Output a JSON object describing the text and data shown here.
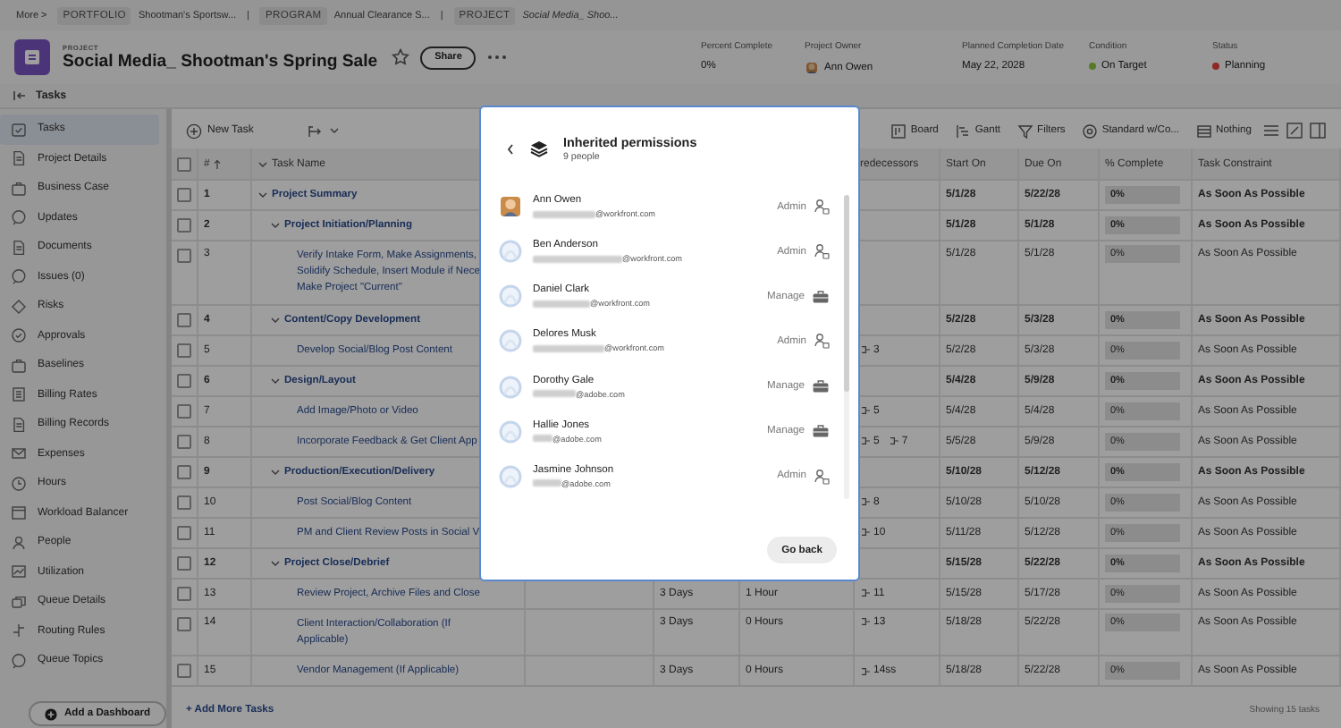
{
  "breadcrumb": {
    "more": "More >",
    "items": [
      {
        "tag": "PORTFOLIO",
        "name": "Shootman's Sportsw...",
        "divider": "|"
      },
      {
        "tag": "PROGRAM",
        "name": "Annual Clearance S...",
        "divider": "|"
      },
      {
        "tag": "PROJECT",
        "name": "Social Media_ Shoo..."
      }
    ]
  },
  "project": {
    "kind_label": "PROJECT",
    "title": "Social Media_ Shootman's Spring Sale",
    "favorite": false,
    "share": "Share"
  },
  "stats": [
    {
      "label": "Percent Complete",
      "value": "0%",
      "kind": "text"
    },
    {
      "label": "Project Owner",
      "value": "Ann Owen",
      "kind": "person"
    },
    {
      "label": "Planned Completion Date",
      "value": "May 22, 2028",
      "kind": "text"
    },
    {
      "label": "Condition",
      "value": "On Target",
      "kind": "status",
      "color": "#577b27"
    },
    {
      "label": "Status",
      "value": "Planning",
      "kind": "status",
      "color": "#902825"
    }
  ],
  "page_title": "Tasks",
  "sidebar": [
    {
      "label": "Tasks",
      "selected": true
    },
    {
      "label": "Project Details",
      "selected": false
    },
    {
      "label": "Business Case",
      "selected": false
    },
    {
      "label": "Updates",
      "selected": false
    },
    {
      "label": "Documents",
      "selected": false
    },
    {
      "label": "Issues (0)",
      "selected": false
    },
    {
      "label": "Risks",
      "selected": false
    },
    {
      "label": "Approvals",
      "selected": false
    },
    {
      "label": "Baselines",
      "selected": false
    },
    {
      "label": "Billing Rates",
      "selected": false
    },
    {
      "label": "Billing Records",
      "selected": false
    },
    {
      "label": "Expenses",
      "selected": false
    },
    {
      "label": "Hours",
      "selected": false
    },
    {
      "label": "Workload Balancer",
      "selected": false
    },
    {
      "label": "People",
      "selected": false
    },
    {
      "label": "Utilization",
      "selected": false
    },
    {
      "label": "Queue Details",
      "selected": false
    },
    {
      "label": "Routing Rules",
      "selected": false
    },
    {
      "label": "Queue Topics",
      "selected": false
    }
  ],
  "dashboard_button": "Add a Dashboard",
  "toolbar": {
    "new_task": "New Task",
    "views": [
      {
        "label": "Board"
      },
      {
        "label": "Gantt"
      },
      {
        "label": "Filters"
      },
      {
        "label": "Standard w/Co..."
      },
      {
        "label": "Nothing"
      }
    ]
  },
  "table": {
    "all_checked": false,
    "columns": {
      "number": "#",
      "name": "Task Name",
      "predecessors": "redecessors",
      "start": "Start On",
      "due": "Due On",
      "complete": "% Complete",
      "constraint": "Task Constraint"
    },
    "rows": [
      {
        "checked": false,
        "number": "1",
        "name": "Project Summary",
        "expanded": true,
        "start": "5/1/28",
        "due": "5/22/28",
        "complete": "0%",
        "level": 0,
        "constraint": "As Soon As Possible",
        "children": [
          {
            "checked": false,
            "number": "2",
            "name": "Project Initiation/Planning",
            "expanded": true,
            "start": "5/1/28",
            "due": "5/1/28",
            "complete": "0%",
            "level": 0,
            "constraint": "As Soon As Possible",
            "children": [
              {
                "checked": false,
                "number": "3",
                "name": "Verify Intake Form, Make Assignments,\nSolidify Schedule, Insert Module if Nece\nMake Project \"Current\"",
                "start": "5/1/28",
                "due": "5/1/28",
                "complete": "0%",
                "level": 0,
                "constraint": "As Soon As Possible"
              }
            ]
          },
          {
            "checked": false,
            "number": "4",
            "name": "Content/Copy Development",
            "expanded": true,
            "start": "5/2/28",
            "due": "5/3/28",
            "complete": "0%",
            "level": 0,
            "constraint": "As Soon As Possible",
            "children": [
              {
                "checked": false,
                "number": "5",
                "name": "Develop Social/Blog Post Content",
                "predecessors": [
                  "3"
                ],
                "start": "5/2/28",
                "due": "5/3/28",
                "complete": "0%",
                "level": 0,
                "constraint": "As Soon As Possible"
              }
            ]
          },
          {
            "checked": false,
            "number": "6",
            "name": "Design/Layout",
            "expanded": true,
            "start": "5/4/28",
            "due": "5/9/28",
            "complete": "0%",
            "level": 0,
            "constraint": "As Soon As Possible",
            "children": [
              {
                "checked": false,
                "number": "7",
                "name": "Add Image/Photo or Video",
                "predecessors": [
                  "5"
                ],
                "start": "5/4/28",
                "due": "5/4/28",
                "complete": "0%",
                "level": 0,
                "constraint": "As Soon As Possible"
              },
              {
                "checked": false,
                "number": "8",
                "name": "Incorporate Feedback & Get Client App",
                "predecessors": [
                  "5",
                  "7"
                ],
                "start": "5/5/28",
                "due": "5/9/28",
                "complete": "0%",
                "level": 0,
                "constraint": "As Soon As Possible"
              }
            ]
          },
          {
            "checked": false,
            "number": "9",
            "name": "Production/Execution/Delivery",
            "expanded": true,
            "start": "5/10/28",
            "due": "5/12/28",
            "complete": "0%",
            "level": 0,
            "constraint": "As Soon As Possible",
            "children": [
              {
                "checked": false,
                "number": "10",
                "name": "Post Social/Blog Content",
                "predecessors": [
                  "8"
                ],
                "start": "5/10/28",
                "due": "5/10/28",
                "complete": "0%",
                "level": 0,
                "constraint": "As Soon As Possible"
              },
              {
                "checked": false,
                "number": "11",
                "name": "PM and Client Review Posts in Social V",
                "predecessors": [
                  "10"
                ],
                "start": "5/11/28",
                "due": "5/12/28",
                "complete": "0%",
                "level": 0,
                "constraint": "As Soon As Possible"
              }
            ]
          },
          {
            "checked": false,
            "number": "12",
            "name": "Project Close/Debrief",
            "expanded": true,
            "start": "5/15/28",
            "due": "5/22/28",
            "complete": "0%",
            "level": 0,
            "constraint": "As Soon As Possible",
            "children": [
              {
                "checked": false,
                "number": "13",
                "name": "Review Project, Archive Files and Close",
                "duration": "3 Days",
                "hours": "1 Hour",
                "predecessors": [
                  "11"
                ],
                "start": "5/15/28",
                "due": "5/17/28",
                "complete": "0%",
                "level": 0,
                "constraint": "As Soon As Possible"
              },
              {
                "checked": false,
                "number": "14",
                "name": "Client Interaction/Collaboration (If\nApplicable)",
                "duration": "3 Days",
                "hours": "0 Hours",
                "predecessors": [
                  "13"
                ],
                "start": "5/18/28",
                "due": "5/22/28",
                "complete": "0%",
                "level": 0,
                "constraint": "As Soon As Possible"
              },
              {
                "checked": false,
                "number": "15",
                "name": "Vendor Management (If Applicable)",
                "duration": "3 Days",
                "hours": "0 Hours",
                "predecessors": [
                  "14ss"
                ],
                "start": "5/18/28",
                "due": "5/22/28",
                "complete": "0%",
                "level": 0,
                "constraint": "As Soon As Possible"
              }
            ]
          }
        ]
      }
    ]
  },
  "add_tasks": "+ Add More Tasks",
  "showing": "Showing 15 tasks",
  "modal": {
    "title": "Inherited permissions",
    "subtitle": "9 people",
    "button": "Go back",
    "people": [
      {
        "name": "Ann Owen",
        "email_domain": "@workfront.com",
        "role": "Admin",
        "kind": "admin",
        "photo": true
      },
      {
        "name": "Ben Anderson",
        "email_domain": "@workfront.com",
        "role": "Admin",
        "kind": "admin",
        "photo": false
      },
      {
        "name": "Daniel Clark",
        "email_domain": "@workfront.com",
        "role": "Manage",
        "kind": "manage",
        "photo": false
      },
      {
        "name": "Delores Musk",
        "email_domain": "@workfront.com",
        "role": "Admin",
        "kind": "admin",
        "photo": false
      },
      {
        "name": "Dorothy Gale",
        "email_domain": "@adobe.com",
        "role": "Manage",
        "kind": "manage",
        "photo": false
      },
      {
        "name": "Hallie Jones",
        "email_domain": "@adobe.com",
        "role": "Manage",
        "kind": "manage",
        "photo": false
      },
      {
        "name": "Jasmine Johnson",
        "email_domain": "@adobe.com",
        "role": "Admin",
        "kind": "admin",
        "photo": false
      }
    ]
  }
}
